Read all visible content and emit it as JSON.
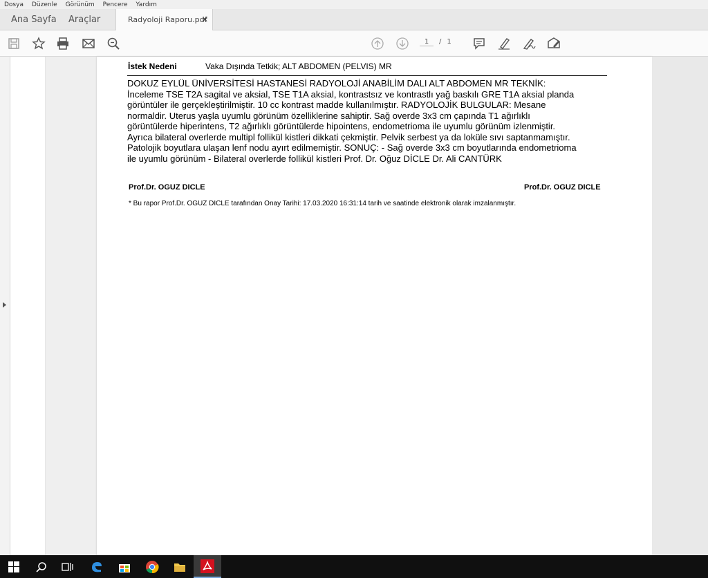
{
  "menu": [
    "Dosya",
    "Düzenle",
    "Görünüm",
    "Pencere",
    "Yardım"
  ],
  "tabs": {
    "home": "Ana Sayfa",
    "tools": "Araçlar",
    "document": "Radyoloji Raporu.pdf",
    "close_glyph": "✕"
  },
  "toolbar_icons": [
    "save-icon",
    "star-icon",
    "print-icon",
    "mail-icon",
    "zoom-icon",
    "page-up-icon",
    "page-down-icon",
    "comment-icon",
    "highlight-icon",
    "sign-icon",
    "fill-sign-icon"
  ],
  "page_nav": {
    "current": "1",
    "separator": "/",
    "total": "1"
  },
  "document": {
    "request_label": "İstek Nedeni",
    "request_value": "Vaka Dışında Tetkik; ALT ABDOMEN (PELVIS) MR",
    "report_lines": [
      "DOKUZ EYLÜL ÜNİVERSİTESİ HASTANESİ RADYOLOJİ ANABİLİM DALI ALT ABDOMEN MR TEKNİK:",
      "İnceleme TSE T2A sagital ve aksial, TSE T1A aksial, kontrastsız ve kontrastlı yağ baskılı GRE T1A aksial planda",
      "görüntüler ile gerçekleştirilmiştir. 10 cc kontrast madde kullanılmıştır. RADYOLOJİK BULGULAR: Mesane",
      "normaldir. Uterus yaşla uyumlu görünüm özelliklerine sahiptir. Sağ overde 3x3 cm çapında T1 ağırlıklı",
      "görüntülerde hiperintens, T2 ağırlıklı görüntülerde hipointens, endometrioma ile uyumlu görünüm izlenmiştir.",
      "Ayrıca bilateral overlerde multipl follikül kistleri dikkati çekmiştir. Pelvik serbest ya da loküle sıvı saptanmamıştır.",
      "Patolojik boyutlara ulaşan lenf nodu ayırt edilmemiştir. SONUÇ: - Sağ overde 3x3 cm boyutlarında endometrioma",
      "ile uyumlu görünüm - Bilateral overlerde follikül kistleri Prof. Dr. Oğuz DİCLE Dr. Ali CANTÜRK"
    ],
    "signature_left": "Prof.Dr. OGUZ DICLE",
    "signature_right": "Prof.Dr. OGUZ DICLE",
    "note": "* Bu rapor Prof.Dr. OGUZ DICLE tarafından Onay Tarihi: 17.03.2020 16:31:14 tarih ve saatinde elektronik olarak imzalanmıştır."
  },
  "taskbar_icons": [
    "windows-start-icon",
    "search-icon",
    "task-view-icon",
    "edge-icon",
    "store-icon",
    "chrome-icon",
    "file-explorer-icon",
    "acrobat-icon"
  ],
  "colors": {
    "accent": "#7aa7d9",
    "taskbar": "#101010",
    "acrobat_red": "#d4121f"
  }
}
